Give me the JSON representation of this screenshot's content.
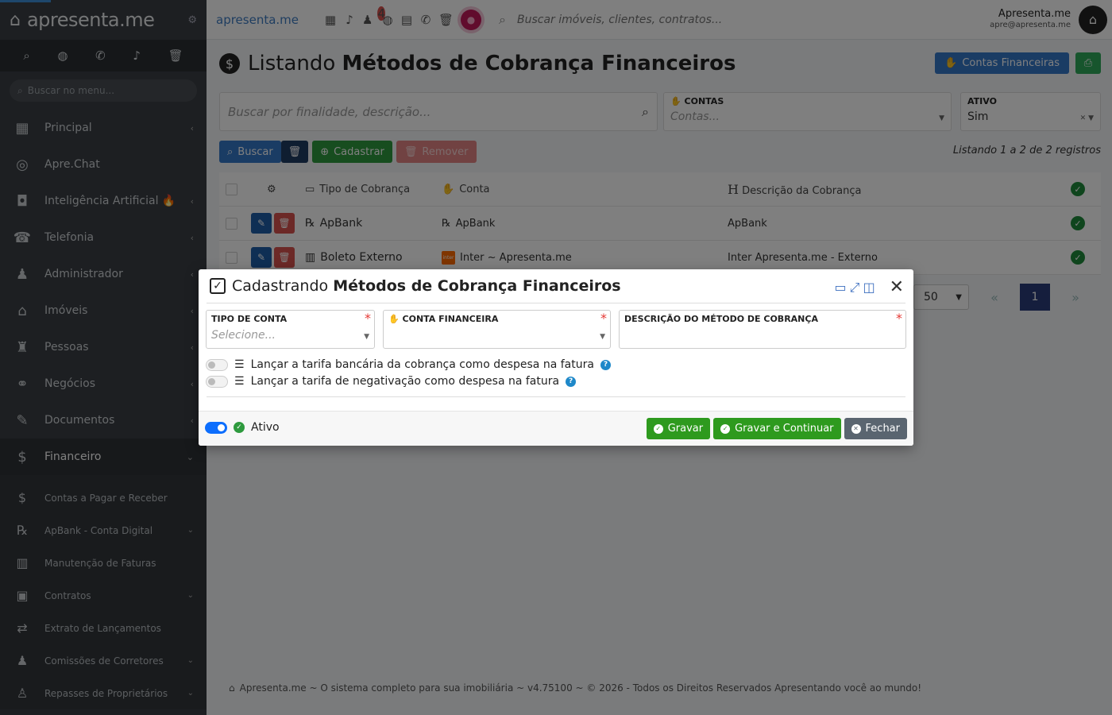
{
  "sidebar": {
    "brand": "apresenta.me",
    "search_placeholder": "Buscar no menu...",
    "items": [
      {
        "label": "Principal",
        "icon": "grid-icon",
        "glyph": "▦",
        "chev": "‹"
      },
      {
        "label": "Apre.Chat",
        "icon": "whatsapp-icon",
        "glyph": "◎",
        "chev": ""
      },
      {
        "label": "Inteligência Artificial 🔥",
        "icon": "robot-icon",
        "glyph": "◘",
        "chev": "‹"
      },
      {
        "label": "Telefonia",
        "icon": "phone-icon",
        "glyph": "☎",
        "chev": "‹"
      },
      {
        "label": "Administrador",
        "icon": "admin-user-icon",
        "glyph": "♟",
        "chev": "‹"
      },
      {
        "label": "Imóveis",
        "icon": "home-icon",
        "glyph": "⌂",
        "chev": "‹"
      },
      {
        "label": "Pessoas",
        "icon": "people-icon",
        "glyph": "♜",
        "chev": "‹"
      },
      {
        "label": "Negócios",
        "icon": "handshake-icon",
        "glyph": "⚭",
        "chev": "‹"
      },
      {
        "label": "Documentos",
        "icon": "document-sign-icon",
        "glyph": "✎",
        "chev": "‹"
      },
      {
        "label": "Financeiro",
        "icon": "dollar-circle-icon",
        "glyph": "$",
        "chev": "⌄"
      }
    ],
    "subitems": [
      {
        "label": "Contas a Pagar e Receber",
        "icon": "dollar-icon",
        "glyph": "$",
        "chev": ""
      },
      {
        "label": "ApBank - Conta Digital",
        "icon": "apbank-icon",
        "glyph": "℞",
        "chev": "⌄"
      },
      {
        "label": "Manutenção de Faturas",
        "icon": "barcode-icon",
        "glyph": "▥",
        "chev": ""
      },
      {
        "label": "Contratos",
        "icon": "contract-icon",
        "glyph": "▣",
        "chev": "⌄"
      },
      {
        "label": "Extrato de Lançamentos",
        "icon": "shuffle-icon",
        "glyph": "⇄",
        "chev": ""
      },
      {
        "label": "Comissões de Corretores",
        "icon": "broker-icon",
        "glyph": "♟",
        "chev": "⌄"
      },
      {
        "label": "Repasses de Proprietários",
        "icon": "owner-transfer-icon",
        "glyph": "♙",
        "chev": "⌄"
      }
    ]
  },
  "topbar": {
    "logo": "apresenta.me",
    "badge": "4",
    "search_placeholder": "Buscar imóveis, clientes, contratos...",
    "user_name": "Apresenta.me",
    "user_email": "apre@apresenta.me"
  },
  "page": {
    "title_prefix": "Listando",
    "title_bold": "Métodos de Cobrança Financeiros",
    "contas_button": "Contas Financeiras",
    "filter_placeholder": "Buscar por finalidade, descrição...",
    "filter_contas_label": "CONTAS",
    "filter_contas_placeholder": "Contas...",
    "filter_ativo_label": "ATIVO",
    "filter_ativo_value": "Sim",
    "btn_buscar": "Buscar",
    "btn_cadastrar": "Cadastrar",
    "btn_remover": "Remover",
    "listing_info": "Listando 1 a 2 de 2 registros",
    "columns": {
      "tipo": "Tipo de Cobrança",
      "conta": "Conta",
      "descricao": "Descrição da Cobrança"
    },
    "rows": [
      {
        "tipo": "ApBank",
        "conta": "ApBank",
        "descricao": "ApBank"
      },
      {
        "tipo": "Boleto Externo",
        "conta": "Inter ~ Apresenta.me",
        "descricao": "Inter Apresenta.me - Externo"
      }
    ],
    "per_page": "50",
    "current_page": "1",
    "footer": "Apresenta.me ~ O sistema completo para sua imobiliária ~ v4.75100 ~ © 2026 - Todos os Direitos Reservados Apresentando você ao mundo!"
  },
  "modal": {
    "title_prefix": "Cadastrando",
    "title_bold": "Métodos de Cobrança Financeiros",
    "field_tipo_label": "TIPO DE CONTA",
    "field_tipo_placeholder": "Selecione...",
    "field_conta_label": "CONTA FINANCEIRA",
    "field_desc_label": "DESCRIÇÃO DO MÉTODO DE COBRANÇA",
    "toggle1": "Lançar a tarifa bancária da cobrança como despesa na fatura",
    "toggle2": "Lançar a tarifa de negativação como despesa na fatura",
    "ativo_label": "Ativo",
    "btn_gravar": "Gravar",
    "btn_gravar_continuar": "Gravar e Continuar",
    "btn_fechar": "Fechar"
  },
  "colors": {
    "accent": "#3478c9",
    "success": "#2e9a3e",
    "danger": "#d9534f",
    "sidebar": "#3a3f44"
  }
}
